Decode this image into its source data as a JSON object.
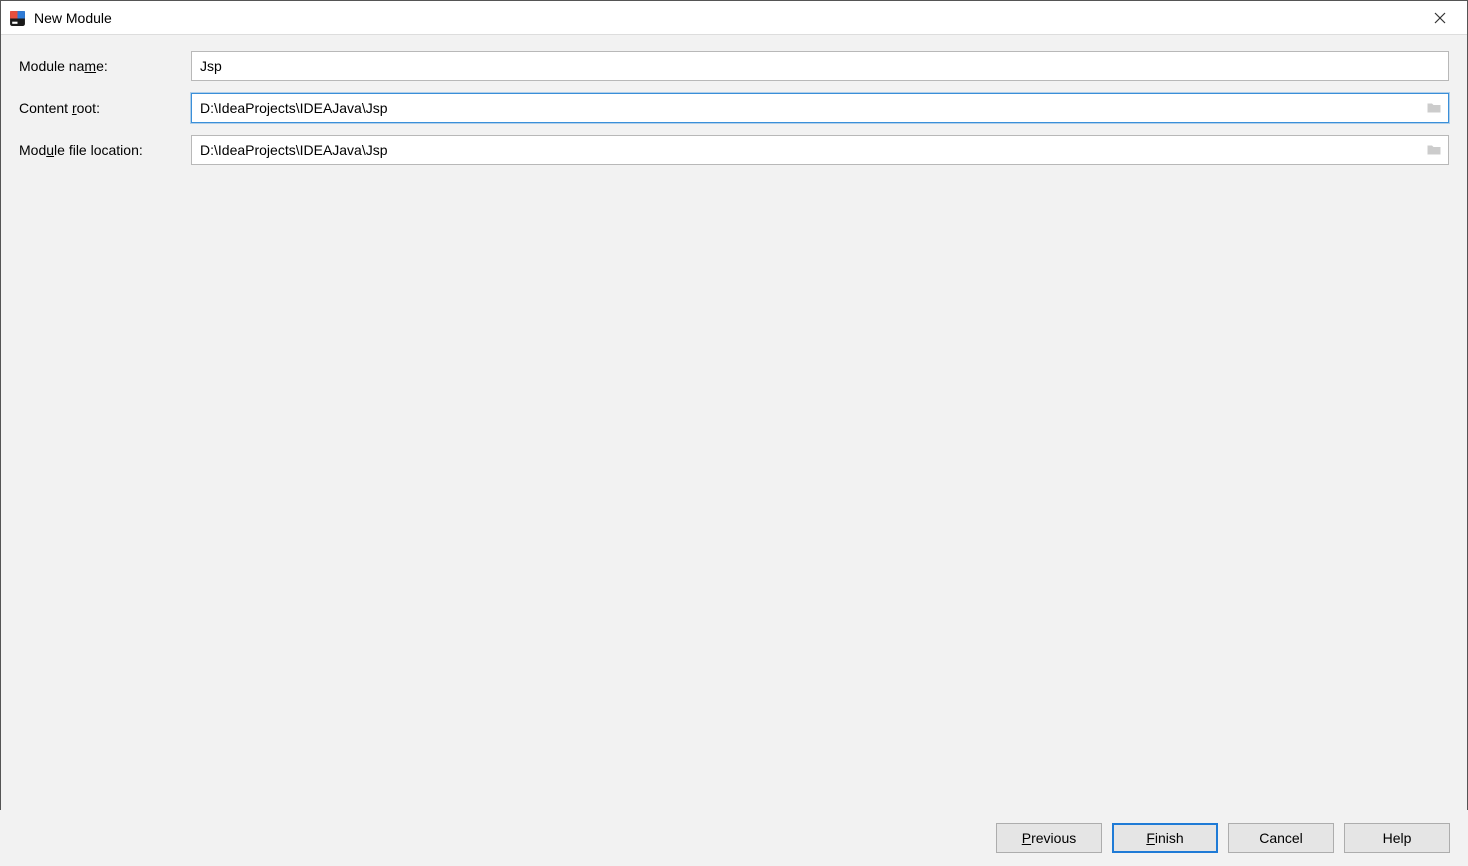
{
  "window": {
    "title": "New Module"
  },
  "form": {
    "moduleName": {
      "label_pre": "Module na",
      "label_mnemonic": "m",
      "label_post": "e:",
      "value": "Jsp"
    },
    "contentRoot": {
      "label_pre": "Content ",
      "label_mnemonic": "r",
      "label_post": "oot:",
      "value": "D:\\IdeaProjects\\IDEAJava\\Jsp"
    },
    "moduleFileLocation": {
      "label_pre": "Mod",
      "label_mnemonic": "u",
      "label_post": "le file location:",
      "value": "D:\\IdeaProjects\\IDEAJava\\Jsp"
    }
  },
  "buttons": {
    "previous_mnemonic": "P",
    "previous_rest": "revious",
    "finish_mnemonic": "F",
    "finish_rest": "inish",
    "cancel": "Cancel",
    "help": "Help"
  }
}
